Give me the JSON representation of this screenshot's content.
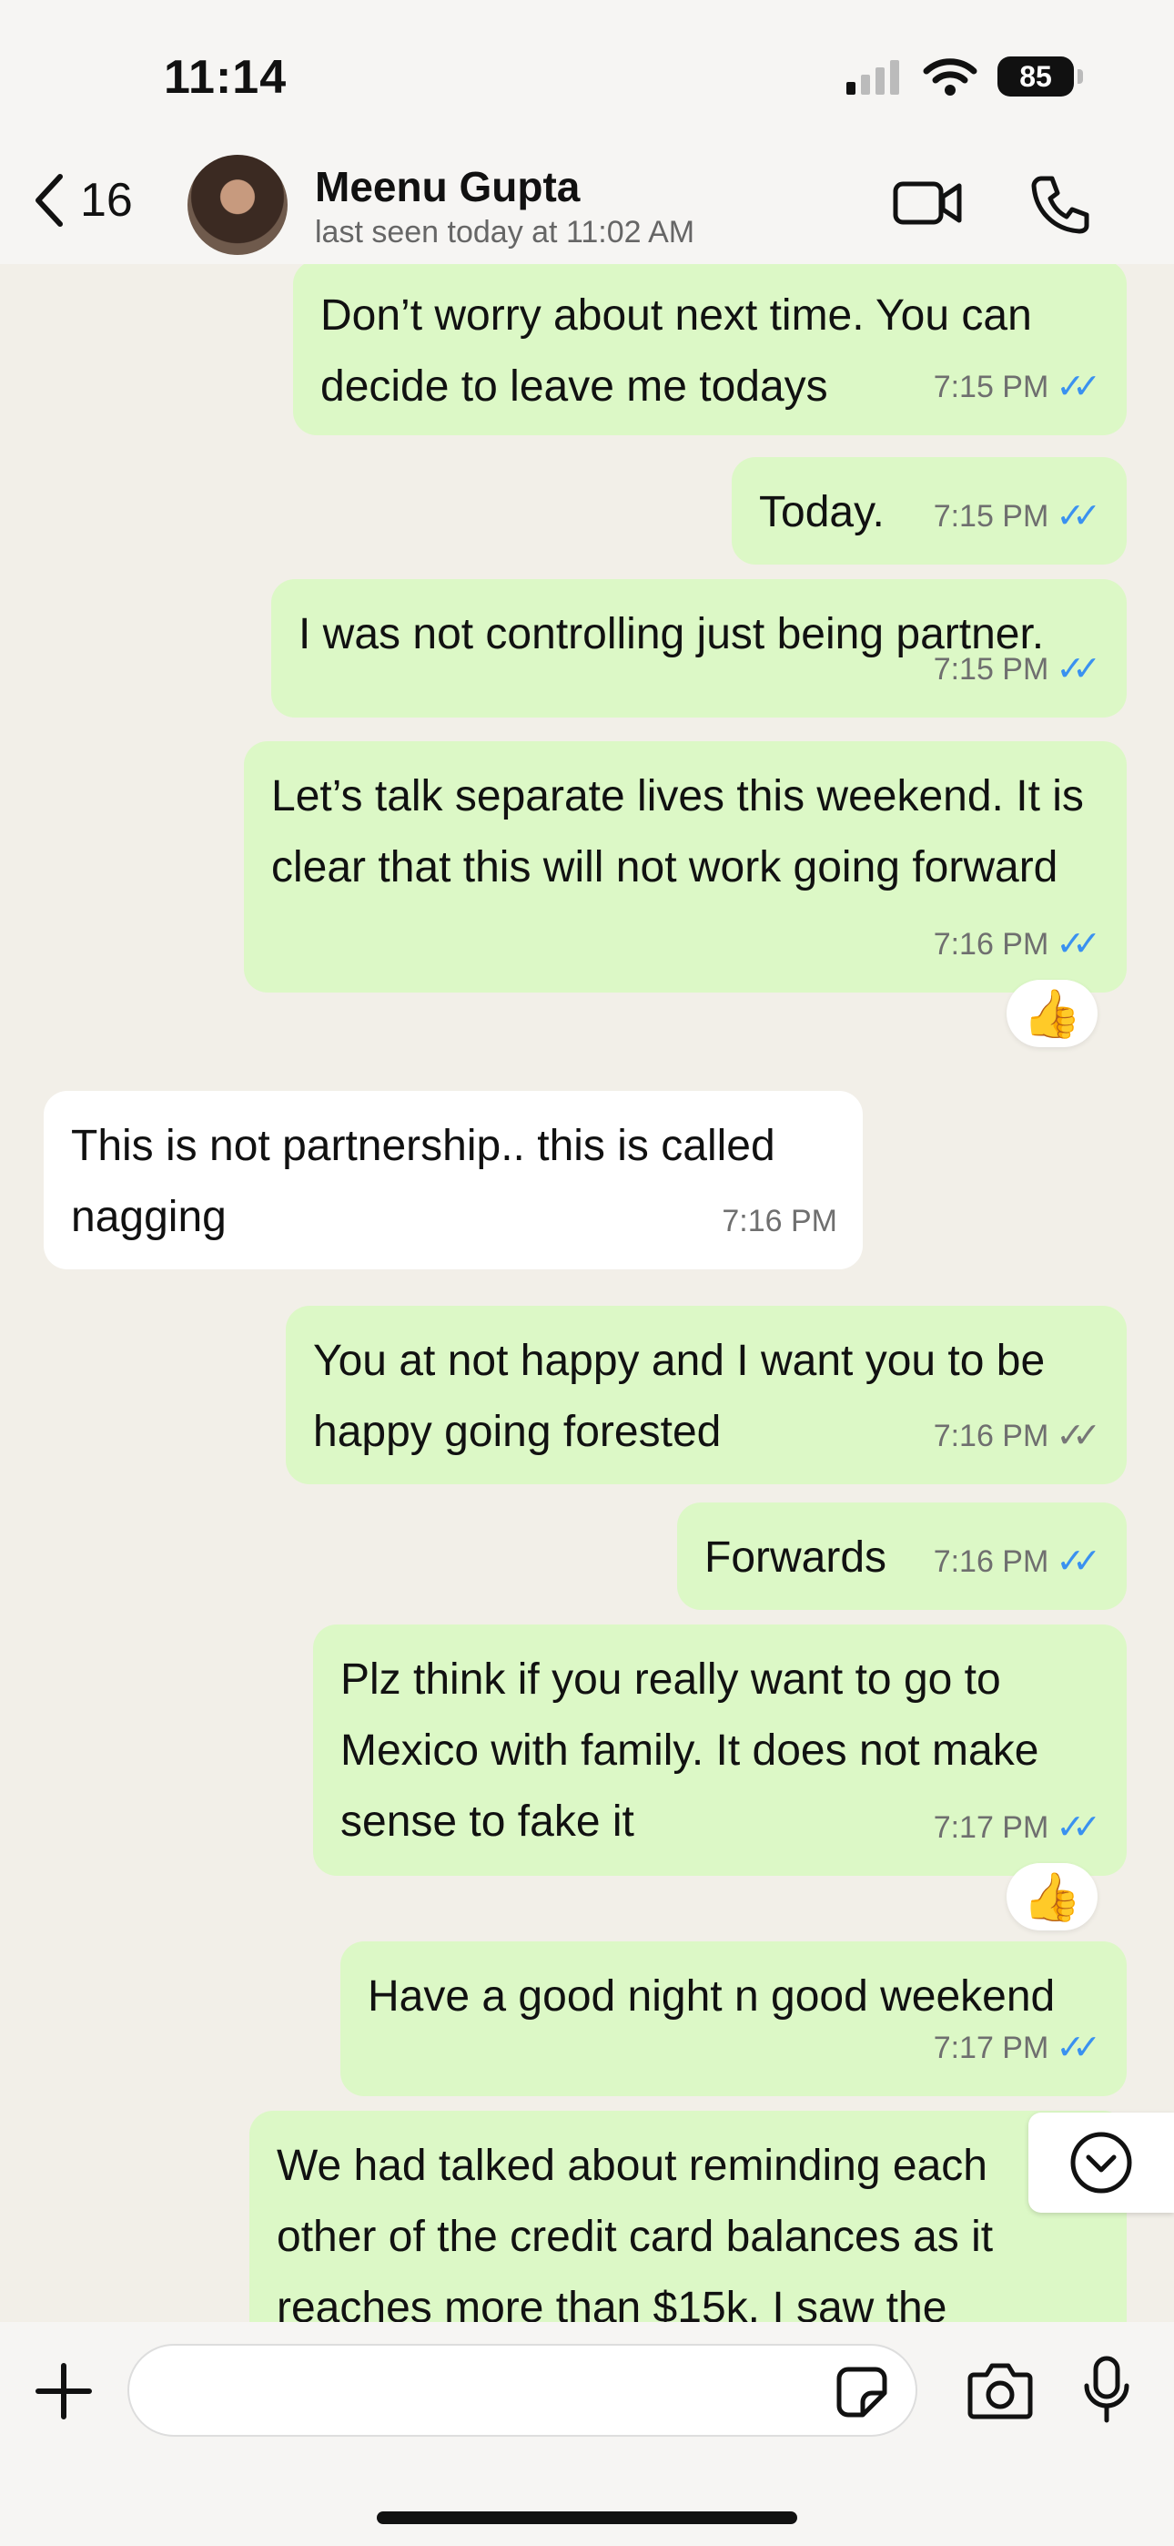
{
  "status_bar": {
    "time": "11:14",
    "battery": "85"
  },
  "header": {
    "back_count": "16",
    "contact_name": "Meenu Gupta",
    "last_seen": "last seen today at 11:02 AM"
  },
  "messages": [
    {
      "dir": "out",
      "text": "Don’t worry about next time. You can decide to leave me todays",
      "time": "7:15 PM",
      "status": "read"
    },
    {
      "dir": "out",
      "text": "Today.",
      "time": "7:15 PM",
      "status": "read"
    },
    {
      "dir": "out",
      "text": "I was not controlling just being partner.",
      "time": "7:15 PM",
      "status": "read"
    },
    {
      "dir": "out",
      "text": "Let’s talk separate lives this weekend. It is clear that this will not work going forward",
      "time": "7:16 PM",
      "status": "read",
      "reaction": "👍"
    },
    {
      "dir": "in",
      "text": "This is not partnership.. this is called nagging",
      "time": "7:16 PM"
    },
    {
      "dir": "out",
      "text": "You at not happy and I want you to be happy going forested",
      "time": "7:16 PM",
      "status": "delivered"
    },
    {
      "dir": "out",
      "text": "Forwards",
      "time": "7:16 PM",
      "status": "read"
    },
    {
      "dir": "out",
      "text": "Plz think if you really want to go to Mexico with family. It does not make sense to fake it",
      "time": "7:17 PM",
      "status": "read",
      "reaction": "👍"
    },
    {
      "dir": "out",
      "text": "Have a good night n good weekend",
      "time": "7:17 PM",
      "status": "read"
    },
    {
      "dir": "out",
      "text": "We had talked about reminding each other of the credit card balances as it reaches more than $15k. I saw the"
    }
  ],
  "tick_glyph": "✓✓",
  "colors": {
    "outgoing": "#dcf8c6",
    "incoming": "#ffffff",
    "read_tick": "#3a91f0"
  }
}
